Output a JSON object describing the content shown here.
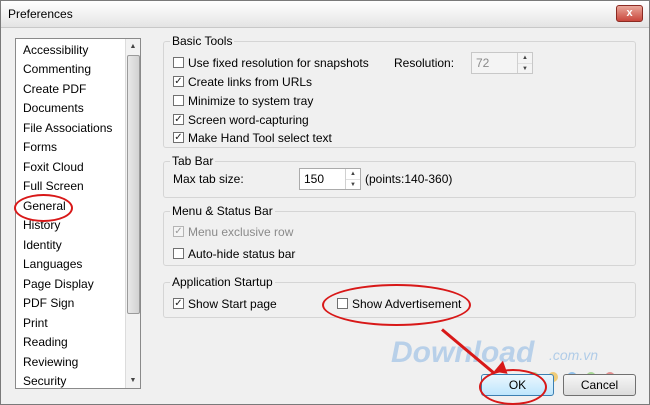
{
  "window": {
    "title": "Preferences",
    "close_label": "x"
  },
  "sidebar": {
    "items": [
      {
        "label": "Accessibility"
      },
      {
        "label": "Commenting"
      },
      {
        "label": "Create PDF"
      },
      {
        "label": "Documents"
      },
      {
        "label": "File Associations"
      },
      {
        "label": "Forms"
      },
      {
        "label": "Foxit Cloud"
      },
      {
        "label": "Full Screen"
      },
      {
        "label": "General"
      },
      {
        "label": "History"
      },
      {
        "label": "Identity"
      },
      {
        "label": "Languages"
      },
      {
        "label": "Page Display"
      },
      {
        "label": "PDF Sign"
      },
      {
        "label": "Print"
      },
      {
        "label": "Reading"
      },
      {
        "label": "Reviewing"
      },
      {
        "label": "Security"
      }
    ],
    "selected": "General"
  },
  "basic_tools": {
    "title": "Basic Tools",
    "fixed_resolution": {
      "label": "Use fixed resolution for snapshots",
      "checked": false
    },
    "resolution_label": "Resolution:",
    "resolution_value": "72",
    "create_links": {
      "label": "Create links from URLs",
      "checked": true
    },
    "minimize_tray": {
      "label": "Minimize to system tray",
      "checked": false
    },
    "word_capturing": {
      "label": "Screen word-capturing",
      "checked": true
    },
    "hand_tool": {
      "label": "Make Hand Tool select text",
      "checked": true
    }
  },
  "tab_bar": {
    "title": "Tab Bar",
    "max_size_label": "Max tab size:",
    "max_size_value": "150",
    "range_hint": "(points:140-360)"
  },
  "menu_status": {
    "title": "Menu & Status Bar",
    "menu_exclusive": {
      "label": "Menu exclusive row",
      "checked": true,
      "disabled": true
    },
    "auto_hide": {
      "label": "Auto-hide status bar",
      "checked": false
    }
  },
  "startup": {
    "title": "Application Startup",
    "show_start": {
      "label": "Show Start page",
      "checked": true
    },
    "show_ad": {
      "label": "Show Advertisement",
      "checked": false
    }
  },
  "buttons": {
    "ok": "OK",
    "cancel": "Cancel"
  },
  "watermark": {
    "brand": "Download",
    "domain": ".com.vn"
  },
  "checkmark_glyph": "✓",
  "colors": {
    "annotation_red": "#d81818",
    "ok_border": "#3c7fb1"
  }
}
